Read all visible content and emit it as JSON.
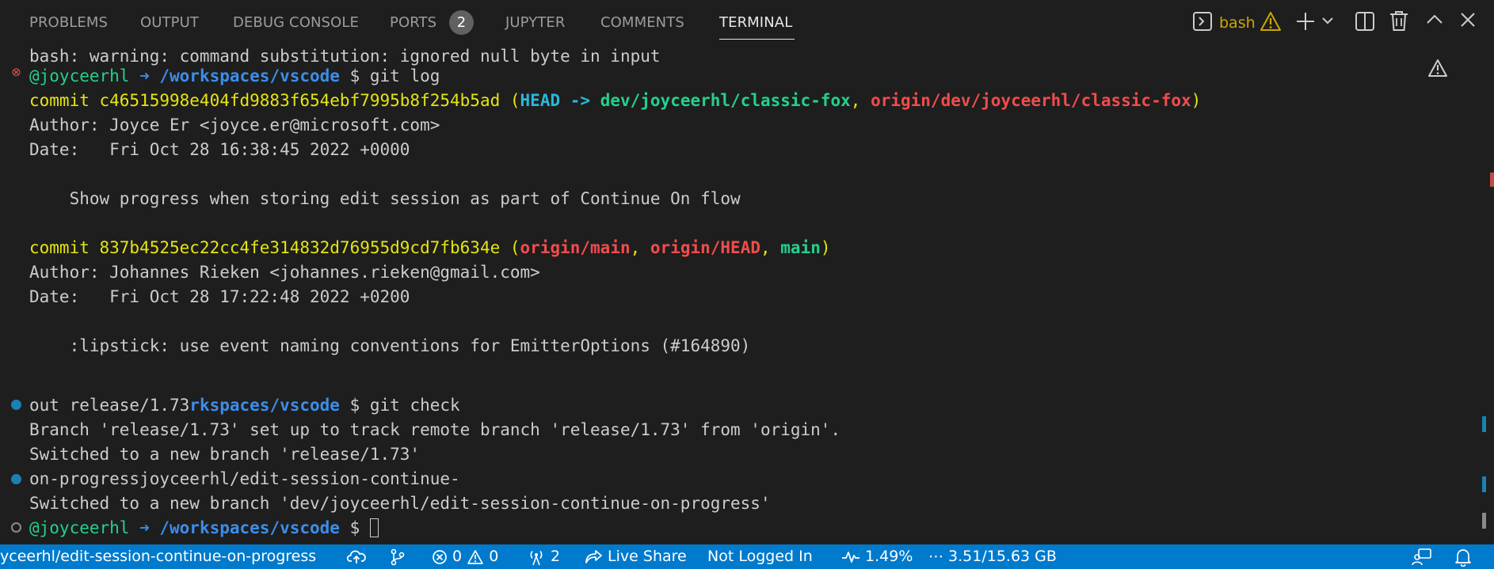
{
  "panel": {
    "tabs": [
      {
        "label": "PROBLEMS"
      },
      {
        "label": "OUTPUT"
      },
      {
        "label": "DEBUG CONSOLE"
      },
      {
        "label": "PORTS",
        "badge": "2"
      },
      {
        "label": "JUPYTER"
      },
      {
        "label": "COMMENTS"
      },
      {
        "label": "TERMINAL",
        "active": true
      }
    ],
    "terminal_name": "bash",
    "actions": [
      "terminal-icon",
      "warning-icon",
      "add-icon",
      "chevron-down-icon",
      "split-icon",
      "trash-icon",
      "maximize-icon",
      "close-icon"
    ]
  },
  "terminal": {
    "l0": "bash: warning: command substitution: ignored null byte in input",
    "l1": {
      "user": "@joyceerhl",
      "arrow": " ➜ ",
      "path": "/workspaces/vscode",
      "rest": " $ git log"
    },
    "l2": {
      "commit": "commit c46515998e404fd9883f654ebf7995b8f254b5ad ",
      "p1": "(",
      "head": "HEAD -> ",
      "branch": "dev/joyceerhl/classic-fox",
      "comma": ", ",
      "remote": "origin/dev/joyceerhl/classic-fox",
      "p2": ")"
    },
    "l3": "Author: Joyce Er <joyce.er@microsoft.com>",
    "l4": "Date:   Fri Oct 28 16:38:45 2022 +0000",
    "l5": "    Show progress when storing edit session as part of Continue On flow",
    "l6": {
      "commit": "commit 837b4525ec22cc4fe314832d76955d9cd7fb634e ",
      "p1": "(",
      "r1": "origin/main",
      "c1": ", ",
      "r2": "origin/HEAD",
      "c2": ", ",
      "g1": "main",
      "p2": ")"
    },
    "l7": "Author: Johannes Rieken <johannes.rieken@gmail.com>",
    "l8": "Date:   Fri Oct 28 17:22:48 2022 +0200",
    "l9": "    :lipstick: use event naming conventions for EmitterOptions (#164890)",
    "l10": {
      "pre": "out release/1.73",
      "path": "rkspaces/vscode",
      "rest": " $ git check"
    },
    "l11": "Branch 'release/1.73' set up to track remote branch 'release/1.73' from 'origin'.",
    "l12": "Switched to a new branch 'release/1.73'",
    "l13": "on-progressjoyceerhl/edit-session-continue-",
    "l14": "Switched to a new branch 'dev/joyceerhl/edit-session-continue-on-progress'",
    "l15": {
      "user": "@joyceerhl",
      "arrow": " ➜ ",
      "path": "/workspaces/vscode",
      "rest": " $ "
    }
  },
  "status_bar": {
    "branch": "yceerhl/edit-session-continue-on-progress",
    "errors": "0",
    "warnings": "0",
    "ports": "2",
    "live_share": "Live Share",
    "login": "Not Logged In",
    "cpu": "1.49%",
    "memory": "3.51/15.63 GB"
  },
  "colors": {
    "background": "#1e1e1e",
    "status_bar": "#007acc",
    "warning": "#cca700",
    "ansi_yellow": "#e5e510",
    "ansi_blue": "#3b8eea",
    "ansi_green": "#23d18b",
    "ansi_red": "#f14c4c",
    "ansi_cyan": "#29b8db"
  }
}
